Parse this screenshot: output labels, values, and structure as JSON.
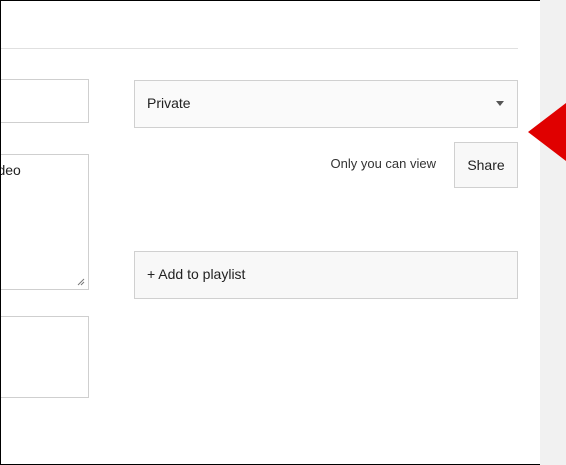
{
  "details": {
    "description_text": "the video\nthe"
  },
  "visibility": {
    "selected_option": "Private",
    "hint": "Only you can view",
    "share_label": "Share"
  },
  "playlist": {
    "add_label": "+ Add to playlist"
  },
  "annotation": {
    "pointer_color": "#e00000"
  }
}
